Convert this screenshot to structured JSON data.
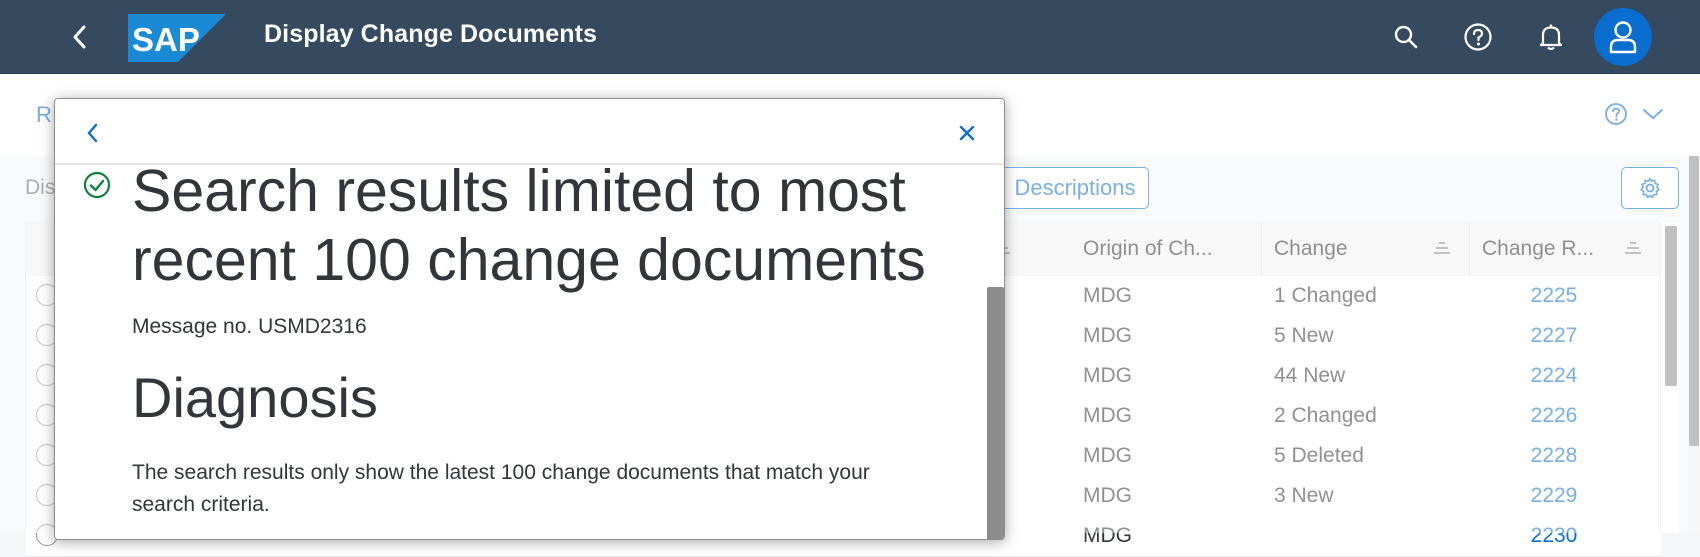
{
  "shell": {
    "title": "Display Change Documents",
    "logo_text": "SAP",
    "brand_color": "#0a6ed1",
    "bar_color": "#354a5f",
    "icons": [
      "back-icon",
      "search-icon",
      "help-icon",
      "bell-icon",
      "user-icon"
    ]
  },
  "background": {
    "subheader_partial": "R",
    "toolbar_partial": "Dis",
    "descriptions_button": "Descriptions"
  },
  "table": {
    "columns": [
      {
        "label": "Origin of Ch..."
      },
      {
        "label": "Change"
      },
      {
        "label": "Change R..."
      }
    ],
    "rows": [
      {
        "origin": "MDG",
        "change": "1 Changed",
        "request": "2225"
      },
      {
        "origin": "MDG",
        "change": "5 New",
        "request": "2227"
      },
      {
        "origin": "MDG",
        "change": "44 New",
        "request": "2224"
      },
      {
        "origin": "MDG",
        "change": "2 Changed",
        "request": "2226"
      },
      {
        "origin": "MDG",
        "change": "5 Deleted",
        "request": "2228"
      },
      {
        "origin": "MDG",
        "change": "3 New",
        "request": "2229"
      },
      {
        "origin": "MDG",
        "change": "",
        "request": "2230"
      }
    ]
  },
  "dialog": {
    "title": "Search results limited to most recent 100 change documents",
    "message_no": "Message no. USMD2316",
    "section_heading": "Diagnosis",
    "section_text": "The search results only show the latest 100 change documents that match your search criteria.",
    "success_color": "#107e3e"
  }
}
